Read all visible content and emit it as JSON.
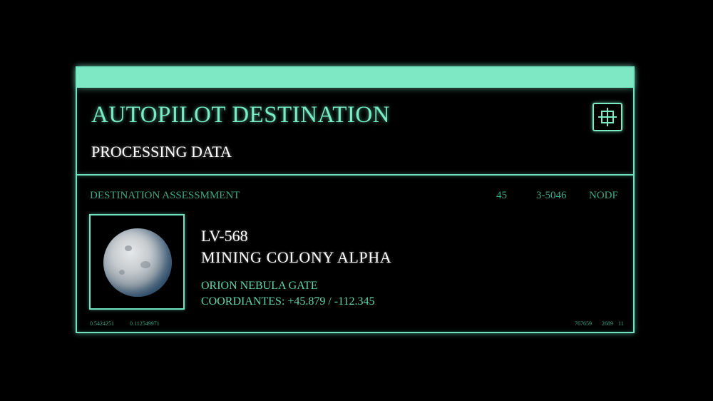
{
  "panel": {
    "title": "AUTOPILOT DESTINATION",
    "status": "PROCESSING DATA",
    "corner_icon": "crosshair-icon"
  },
  "assessment": {
    "label": "DESTINATION ASSESSMMENT",
    "value_1": "45",
    "value_2": "3-5046",
    "code": "NODF"
  },
  "destination": {
    "image_icon": "planet-icon",
    "id": "LV-568",
    "name": "MINING COLONY ALPHA",
    "region": "ORION NEBULA GATE",
    "coordinates": "COORDIANTES: +45.879 / -112.345"
  },
  "footer_readouts": {
    "left_1": "0.5424251",
    "left_2": "0.112549971",
    "right_1": "767659",
    "right_2": "2689",
    "right_3": "11"
  },
  "colors": {
    "accent": "#79ecc6",
    "bar": "#7ee7c4",
    "dim_text": "#3fa888",
    "background": "#000000",
    "primary_text": "#ffffff"
  }
}
